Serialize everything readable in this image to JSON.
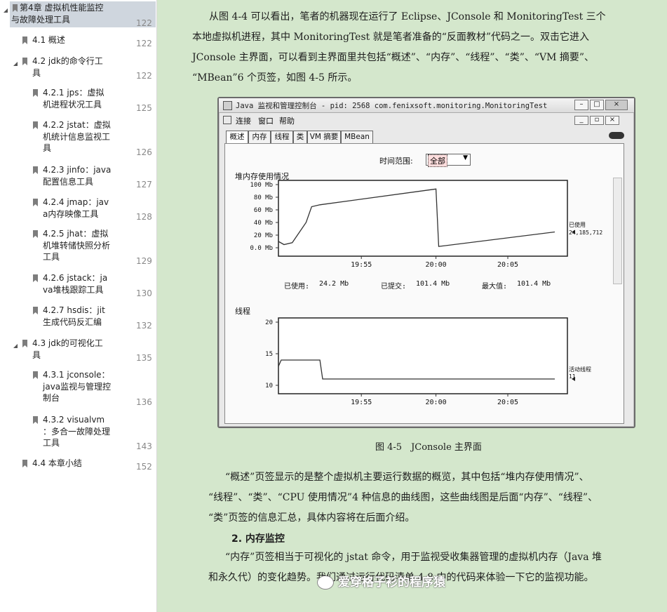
{
  "toc": [
    {
      "title_line1": "第4章 虚拟机性能监控",
      "title_line2": "与故障处理工具",
      "page": "122",
      "selected": true
    },
    {
      "title_line1": "4.1 概述",
      "title_line2": "",
      "page": "122"
    },
    {
      "title_line1": "4.2 jdk的命令行工",
      "title_line2": "具",
      "page": "122"
    },
    {
      "title_line1": "4.2.1 jps：虚拟",
      "title_line2": "机进程状况工具",
      "page": "125"
    },
    {
      "title_line1": "4.2.2 jstat：虚拟",
      "title_line2": "机统计信息监视工",
      "title_line3": "具",
      "page": "126"
    },
    {
      "title_line1": "4.2.3 jinfo：java",
      "title_line2": "配置信息工具",
      "page": "127"
    },
    {
      "title_line1": "4.2.4 jmap：jav",
      "title_line2": "a内存映像工具",
      "page": "128"
    },
    {
      "title_line1": "4.2.5 jhat：虚拟",
      "title_line2": "机堆转储快照分析",
      "title_line3": "工具",
      "page": "129"
    },
    {
      "title_line1": "4.2.6 jstack：ja",
      "title_line2": "va堆栈跟踪工具",
      "page": "130"
    },
    {
      "title_line1": "4.2.7 hsdis：jit",
      "title_line2": "生成代码反汇编",
      "page": "132"
    },
    {
      "title_line1": "4.3 jdk的可视化工",
      "title_line2": "具",
      "page": "135"
    },
    {
      "title_line1": "4.3.1 jconsole：",
      "title_line2": "java监视与管理控",
      "title_line3": "制台",
      "page": "136"
    },
    {
      "title_line1": "4.3.2 visualvm",
      "title_line2": "：多合一故障处理",
      "title_line3": "工具",
      "page": "143"
    },
    {
      "title_line1": "4.4 本章小结",
      "title_line2": "",
      "page": "152"
    }
  ],
  "doc": {
    "p1": [
      "从图 4-4 可以看出，笔者的机器现在运行了 Eclipse、JConsole 和 MonitoringTest 三个",
      "本地虚拟机进程，其中 MonitoringTest 就是笔者准备的“反面教材”代码之一。双击它进入",
      "JConsole 主界面，可以看到主界面里共包括“概述”、“内存”、“线程”、“类”、“VM 摘要”、",
      "“MBean”6 个页签，如图 4-5 所示。"
    ],
    "caption": "图 4-5　JConsole 主界面",
    "p2": [
      "“概述”页签显示的是整个虚拟机主要运行数据的概览，其中包括“堆内存使用情况”、",
      "“线程”、“类”、“CPU 使用情况”4 种信息的曲线图，这些曲线图是后面“内存”、“线程”、",
      "“类”页签的信息汇总，具体内容将在后面介绍。"
    ],
    "heading": "2. 内存监控",
    "p3": [
      "“内存”页签相当于可视化的 jstat 命令，用于监视受收集器管理的虚拟机内存（Java 堆",
      "和永久代）的变化趋势。我们通过运行代码清单 4-8 中的代码来体验一下它的监视功能。"
    ],
    "watermark": "爱穿格子衫的程序猿"
  },
  "window": {
    "title": "Java 监视和管理控制台 - pid: 2568 com.fenixsoft.monitoring.MonitoringTest",
    "menu": [
      "连接",
      "窗口",
      "帮助"
    ],
    "tabs": [
      "概述",
      "内存",
      "线程",
      "类",
      "VM 摘要",
      "MBean"
    ],
    "time_range_label": "时间范围:",
    "time_range_value": "全部",
    "heap_title": "堆内存使用情况",
    "heap_used_label": "已使用",
    "heap_used_value": "24,185,712",
    "heap_stats": {
      "used_label": "已使用:",
      "used": "24.2 Mb",
      "committed_label": "已提交:",
      "committed": "101.4 Mb",
      "max_label": "最大值:",
      "max": "101.4 Mb"
    },
    "threads_title": "线程",
    "threads_label": "活动线程",
    "threads_value": "11"
  },
  "chart_data": [
    {
      "type": "line",
      "title": "堆内存使用情况",
      "x_ticks": [
        "19:55",
        "20:00",
        "20:05"
      ],
      "y_ticks": [
        "100 Mb",
        "80 Mb",
        "60 Mb",
        "40 Mb",
        "20 Mb",
        "0.0 Mb"
      ],
      "ylim": [
        0,
        100
      ],
      "series": [
        {
          "name": "已使用",
          "points": [
            [
              0.0,
              10
            ],
            [
              0.02,
              5
            ],
            [
              0.05,
              8
            ],
            [
              0.1,
              40
            ],
            [
              0.12,
              65
            ],
            [
              0.15,
              68
            ],
            [
              0.57,
              93
            ],
            [
              0.58,
              2
            ],
            [
              1.0,
              25
            ]
          ]
        }
      ]
    },
    {
      "type": "line",
      "title": "线程",
      "x_ticks": [
        "19:55",
        "20:00",
        "20:05"
      ],
      "y_ticks": [
        "20",
        "15",
        "10"
      ],
      "ylim": [
        10,
        20
      ],
      "series": [
        {
          "name": "活动线程",
          "points": [
            [
              0.0,
              13
            ],
            [
              0.01,
              14
            ],
            [
              0.15,
              14
            ],
            [
              0.16,
              11
            ],
            [
              1.0,
              11
            ]
          ]
        }
      ]
    }
  ]
}
